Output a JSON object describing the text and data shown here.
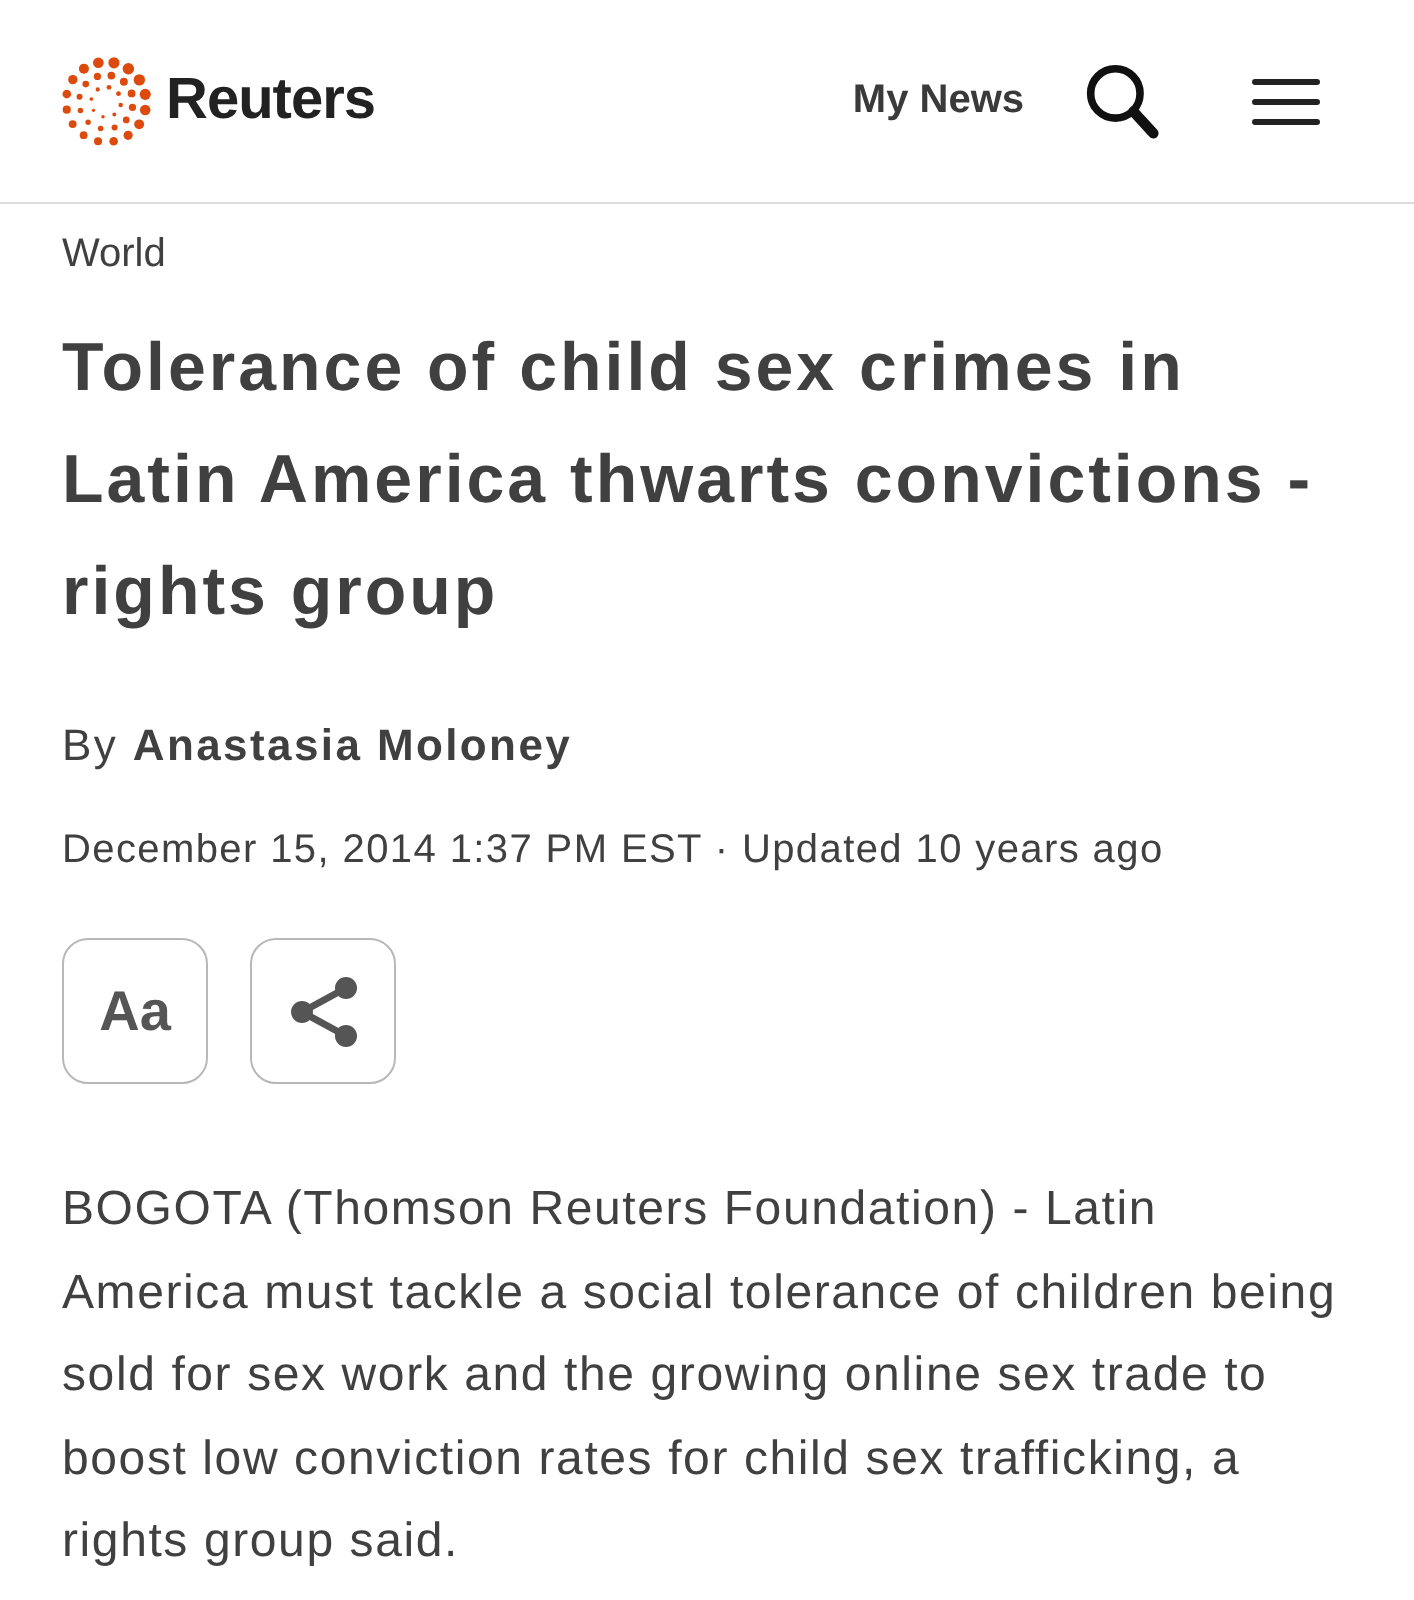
{
  "header": {
    "logo_text": "Reuters",
    "nav_link": "My News"
  },
  "article": {
    "section": "World",
    "headline": "Tolerance of child sex crimes in Latin America thwarts convictions - rights group",
    "byline": "By **Anastasia Moloney**",
    "dateline": "December 15, 2014 1:37 PM EST · Updated 10 years ago",
    "text_size_button": "Aa",
    "paragraphs": [
      "BOGOTA (Thomson Reuters Foundation) - Latin America must tackle a social tolerance of children being sold for sex work and the growing online sex trade to boost low conviction rates for child sex trafficking, a rights group said."
    ]
  }
}
